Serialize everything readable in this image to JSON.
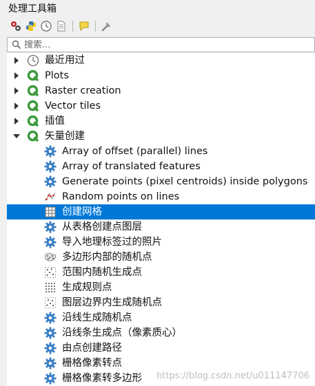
{
  "panel": {
    "title": "处理工具箱"
  },
  "toolbar": {
    "buttons": [
      {
        "icon": "models-icon"
      },
      {
        "icon": "python-icon"
      },
      {
        "icon": "history-icon"
      },
      {
        "icon": "results-icon"
      },
      {
        "icon": "edit-features-icon"
      },
      {
        "icon": "options-icon"
      }
    ]
  },
  "search": {
    "placeholder": "搜索...",
    "value": ""
  },
  "tree": {
    "groups": [
      {
        "label": "最近用过",
        "icon": "clock-icon",
        "expanded": false
      },
      {
        "label": "Plots",
        "icon": "qgis-icon",
        "expanded": false
      },
      {
        "label": "Raster creation",
        "icon": "qgis-icon",
        "expanded": false
      },
      {
        "label": "Vector tiles",
        "icon": "qgis-icon",
        "expanded": false
      },
      {
        "label": "插值",
        "icon": "qgis-icon",
        "expanded": false
      },
      {
        "label": "矢量创建",
        "icon": "qgis-icon",
        "expanded": true
      }
    ],
    "tools": [
      {
        "label": "Array of offset (parallel) lines",
        "icon": "gear-icon"
      },
      {
        "label": "Array of translated features",
        "icon": "gear-icon"
      },
      {
        "label": "Generate points (pixel centroids) inside polygons",
        "icon": "gear-icon"
      },
      {
        "label": "Random points on lines",
        "icon": "random-points-lines-icon"
      },
      {
        "label": "创建网格",
        "icon": "grid-icon",
        "selected": true
      },
      {
        "label": "从表格创建点图层",
        "icon": "gear-icon"
      },
      {
        "label": "导入地理标签过的照片",
        "icon": "gear-icon"
      },
      {
        "label": "多边形内部的随机点",
        "icon": "random-points-polygon-icon"
      },
      {
        "label": "范围内随机生成点",
        "icon": "random-points-extent-icon"
      },
      {
        "label": "生成规则点",
        "icon": "regular-points-icon"
      },
      {
        "label": "图层边界内生成随机点",
        "icon": "random-points-layer-icon"
      },
      {
        "label": "沿线生成随机点",
        "icon": "gear-icon"
      },
      {
        "label": "沿线条生成点（像素质心）",
        "icon": "gear-icon"
      },
      {
        "label": "由点创建路径",
        "icon": "gear-icon"
      },
      {
        "label": "栅格像素转点",
        "icon": "gear-icon"
      },
      {
        "label": "栅格像素转多边形",
        "icon": "gear-icon"
      }
    ]
  },
  "watermark": "https://blog.csdn.net/u011147706",
  "colors": {
    "selection": "#0078d7",
    "qgis_green": "#3c9a3c",
    "gear_blue": "#3a7fc4"
  }
}
